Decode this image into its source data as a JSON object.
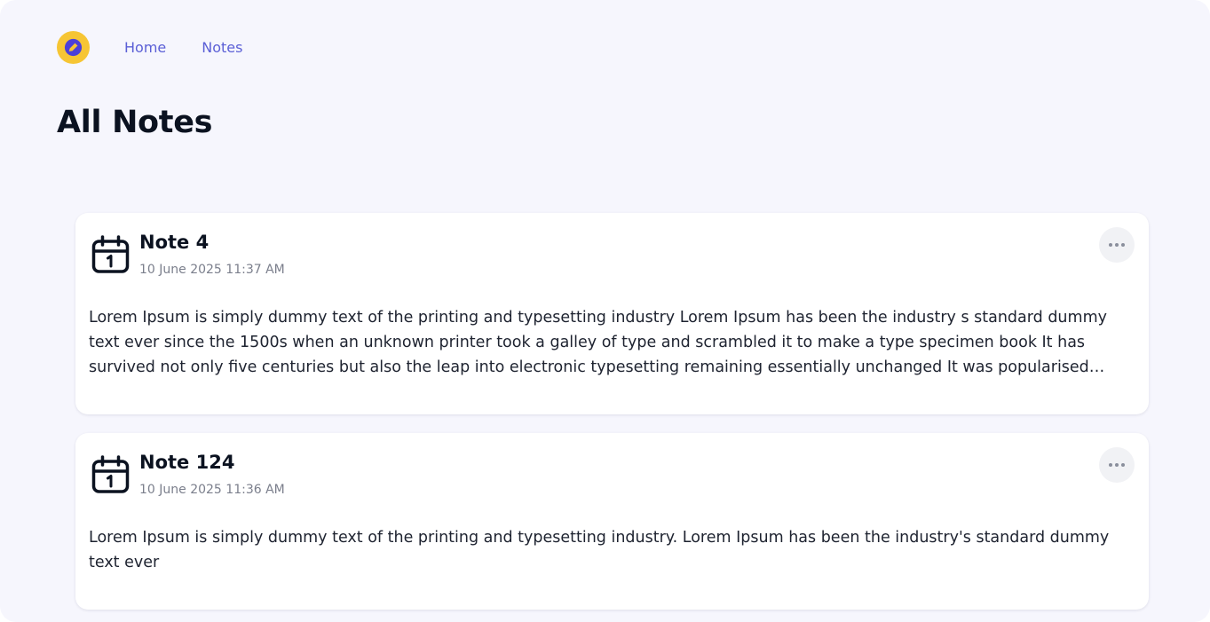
{
  "nav": {
    "logo_icon": "pen-icon",
    "links": [
      {
        "label": "Home"
      },
      {
        "label": "Notes"
      }
    ]
  },
  "page": {
    "title": "All Notes"
  },
  "notes": [
    {
      "icon": "calendar-icon",
      "title": "Note 4",
      "date": "10 June 2025 11:37 AM",
      "body": "Lorem Ipsum is simply dummy text of the printing and typesetting industry Lorem Ipsum has been the industry s standard dummy text ever since the 1500s when an unknown printer took a galley of type and scrambled it to make a type specimen book It has survived not only five centuries but also the leap into electronic typesetting remaining essentially unchanged It was popularised in..."
    },
    {
      "icon": "calendar-icon",
      "title": "Note 124",
      "date": "10 June 2025 11:36 AM",
      "body": "Lorem Ipsum is simply dummy text of the printing and typesetting industry. Lorem Ipsum has been the industry's standard dummy text ever"
    }
  ],
  "colors": {
    "background": "#f6f6fd",
    "accent": "#5b5fd6",
    "logo": "#f6c534",
    "logo_mark": "#4b3fd8"
  }
}
